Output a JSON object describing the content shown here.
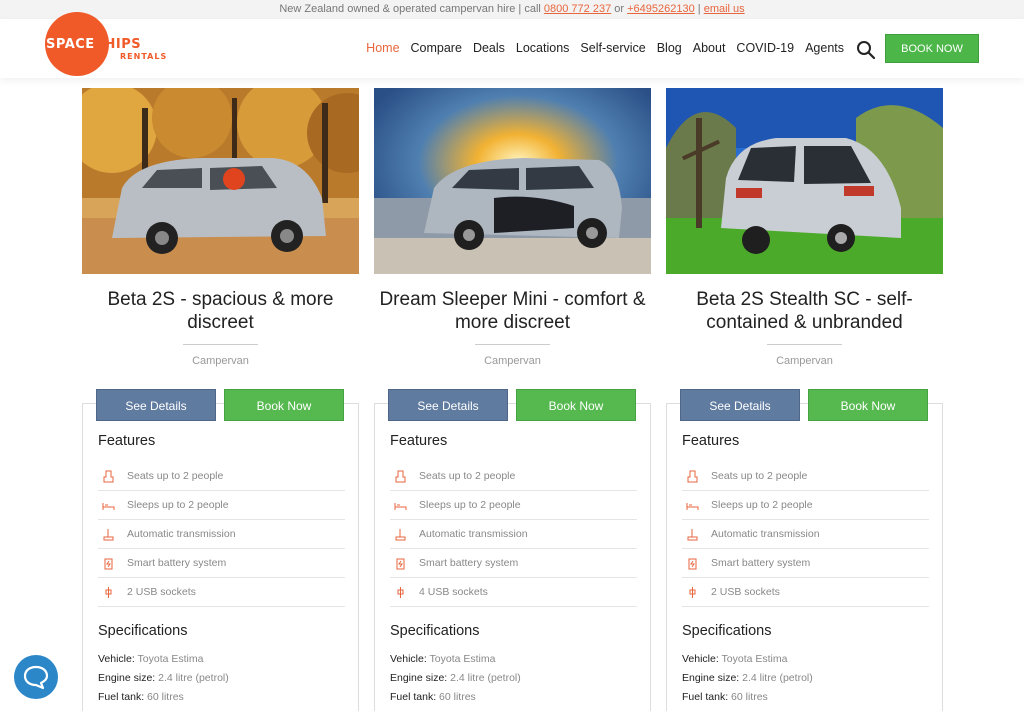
{
  "topbar": {
    "prefix": "New Zealand owned & operated campervan hire | call",
    "phone1": "0800 772 237",
    "or": "or",
    "phone2": "+6495262130",
    "sep": "|",
    "email": "email us"
  },
  "logo": {
    "word_space": "SPACE",
    "word_ships": "SHIPS",
    "sub": "RENTALS"
  },
  "nav": [
    "Home",
    "Compare",
    "Deals",
    "Locations",
    "Self-service",
    "Blog",
    "About",
    "COVID-19",
    "Agents"
  ],
  "book_now_header": "BOOK NOW",
  "colors": {
    "accent": "#e8663d",
    "green": "#4cb648",
    "slate": "#607ba0"
  },
  "cards": [
    {
      "title": "Beta 2S - spacious & more discreet",
      "type": "Campervan",
      "see_details": "See Details",
      "book_now": "Book Now",
      "features_heading": "Features",
      "features": [
        "Seats up to 2 people",
        "Sleeps up to 2 people",
        "Automatic transmission",
        "Smart battery system",
        "2 USB sockets"
      ],
      "specs_heading": "Specifications",
      "specs": [
        {
          "label": "Vehicle:",
          "value": "Toyota Estima"
        },
        {
          "label": "Engine size:",
          "value": "2.4 litre (petrol)"
        },
        {
          "label": "Fuel tank:",
          "value": "60 litres"
        }
      ]
    },
    {
      "title": "Dream Sleeper Mini - comfort & more discreet",
      "type": "Campervan",
      "see_details": "See Details",
      "book_now": "Book Now",
      "features_heading": "Features",
      "features": [
        "Seats up to 2 people",
        "Sleeps up to 2 people",
        "Automatic transmission",
        "Smart battery system",
        "4 USB sockets"
      ],
      "specs_heading": "Specifications",
      "specs": [
        {
          "label": "Vehicle:",
          "value": "Toyota Estima"
        },
        {
          "label": "Engine size:",
          "value": "2.4 litre (petrol)"
        },
        {
          "label": "Fuel tank:",
          "value": "60 litres"
        }
      ]
    },
    {
      "title": "Beta 2S Stealth SC - self-contained & unbranded",
      "type": "Campervan",
      "see_details": "See Details",
      "book_now": "Book Now",
      "features_heading": "Features",
      "features": [
        "Seats up to 2 people",
        "Sleeps up to 2 people",
        "Automatic transmission",
        "Smart battery system",
        "2 USB sockets"
      ],
      "specs_heading": "Specifications",
      "specs": [
        {
          "label": "Vehicle:",
          "value": "Toyota Estima"
        },
        {
          "label": "Engine size:",
          "value": "2.4 litre (petrol)"
        },
        {
          "label": "Fuel tank:",
          "value": "60 litres"
        }
      ]
    }
  ]
}
